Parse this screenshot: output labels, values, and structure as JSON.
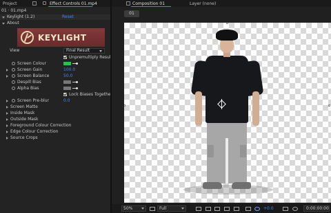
{
  "tabs": {
    "project": "Project",
    "effect_controls": "Effect Controls 01.mp4",
    "composition": "Composition 01",
    "layer": "Layer (none)"
  },
  "effects": {
    "breadcrumb": "01 · 01.mp4",
    "effect_name": "Keylight (1.2)",
    "reset": "Reset",
    "about": "About",
    "logo_text": "KEYLIGHT",
    "view_label": "View",
    "view_value": "Final Result",
    "unpremultiply": "Unpremultiply Result",
    "screen_colour": "Screen Colour",
    "screen_colour_swatch": "#27c24a",
    "screen_gain": "Screen Gain",
    "screen_gain_value": "100.0",
    "screen_balance": "Screen Balance",
    "screen_balance_value": "50.0",
    "despill_bias": "Despill Bias",
    "alpha_bias": "Alpha Bias",
    "bias_swatch": "#777777",
    "lock_biases": "Lock Biases Together",
    "screen_preblur": "Screen Pre-blur",
    "screen_preblur_value": "0.0",
    "groups": [
      "Screen Matte",
      "Inside Mask",
      "Outside Mask",
      "Foreground Colour Correction",
      "Edge Colour Correction",
      "Source Crops"
    ]
  },
  "composition": {
    "chip": "01",
    "zoom": "50%",
    "resolution": "Full",
    "exposure": "+0.0",
    "timecode": "0:00:00:00"
  }
}
